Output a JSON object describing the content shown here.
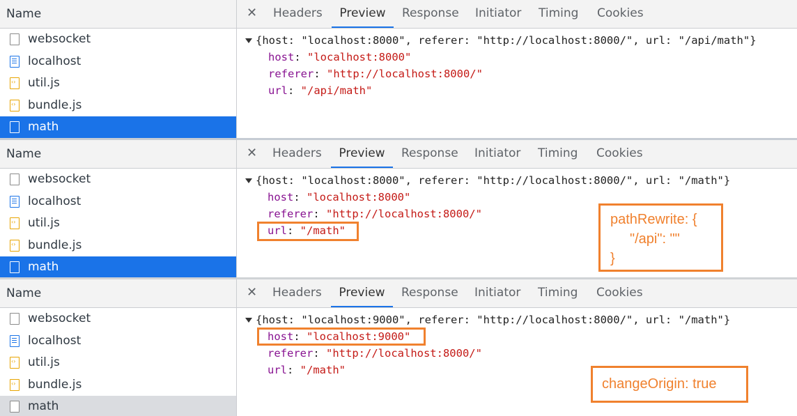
{
  "name_header": "Name",
  "files": [
    {
      "name": "websocket",
      "icon": "document-icon"
    },
    {
      "name": "localhost",
      "icon": "html-document-icon"
    },
    {
      "name": "util.js",
      "icon": "script-icon"
    },
    {
      "name": "bundle.js",
      "icon": "script-icon"
    },
    {
      "name": "math",
      "icon": "document-icon"
    }
  ],
  "tabs": {
    "close": "✕",
    "headers": "Headers",
    "preview": "Preview",
    "response": "Response",
    "initiator": "Initiator",
    "timing": "Timing",
    "cookies": "Cookies"
  },
  "p1": {
    "summary": "{host: \"localhost:8000\", referer: \"http://localhost:8000/\", url: \"/api/math\"}",
    "host": "\"localhost:8000\"",
    "referer": "\"http://localhost:8000/\"",
    "url": "\"/api/math\""
  },
  "p2": {
    "summary": "{host: \"localhost:8000\", referer: \"http://localhost:8000/\", url: \"/math\"}",
    "host": "\"localhost:8000\"",
    "referer": "\"http://localhost:8000/\"",
    "url": "\"/math\""
  },
  "p3": {
    "summary": "{host: \"localhost:9000\", referer: \"http://localhost:8000/\", url: \"/math\"}",
    "host": "\"localhost:9000\"",
    "referer": "\"http://localhost:8000/\"",
    "url": "\"/math\""
  },
  "keys": {
    "host": "host",
    "referer": "referer",
    "url": "url",
    "colon": ": "
  },
  "annotations": {
    "path_rewrite_1": "pathRewrite: {",
    "path_rewrite_2": "\"/api\": \"\"",
    "path_rewrite_3": "}",
    "change_origin": "changeOrigin: true"
  },
  "colors": {
    "selection": "#1a73e8",
    "annotation": "#f0812e"
  }
}
